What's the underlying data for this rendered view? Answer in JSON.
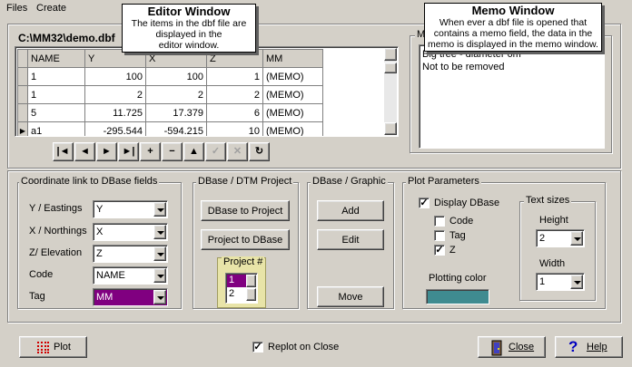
{
  "menu": {
    "files": "Files",
    "create": "Create"
  },
  "file_path": "C:\\MM32\\demo.dbf",
  "memo_group": "MM",
  "callouts": {
    "editor": {
      "title": "Editor Window",
      "line1": "The items in the dbf file are",
      "line2": "displayed in the",
      "line3": "editor window."
    },
    "memo": {
      "title": "Memo Window",
      "line1": "When ever a dbf file is opened that",
      "line2": "contains a memo field, the data in the",
      "line3": "memo is displayed in the memo window."
    }
  },
  "grid": {
    "headers": [
      "NAME",
      "Y",
      "X",
      "Z",
      "MM"
    ],
    "rows": [
      [
        "1",
        "100",
        "100",
        "1",
        "(MEMO)"
      ],
      [
        "1",
        "2",
        "2",
        "2",
        "(MEMO)"
      ],
      [
        "5",
        "11.725",
        "17.379",
        "6",
        "(MEMO)"
      ],
      [
        "a1",
        "-295.544",
        "-594.215",
        "10",
        "(MEMO)"
      ]
    ]
  },
  "memo_text": {
    "line1": "Big tree - diameter 6m",
    "line2": "Not to be removed"
  },
  "nav": [
    "|◄",
    "◄",
    "►",
    "►|",
    "+",
    "−",
    "▲",
    "✓",
    "✕",
    "↻"
  ],
  "coord": {
    "title": "Coordinate link to DBase fields",
    "rows": [
      {
        "label": "Y / Eastings",
        "value": "Y"
      },
      {
        "label": "X / Northings",
        "value": "X"
      },
      {
        "label": "Z/ Elevation",
        "value": "Z"
      },
      {
        "label": "Code",
        "value": "NAME"
      },
      {
        "label": "Tag",
        "value": "MM"
      }
    ]
  },
  "dtm": {
    "title": "DBase / DTM Project",
    "to_project": "DBase to Project",
    "to_dbase": "Project to DBase",
    "project_title": "Project #",
    "project_items": [
      "1",
      "2"
    ]
  },
  "graphic": {
    "title": "DBase / Graphic",
    "add": "Add",
    "edit": "Edit",
    "move": "Move"
  },
  "plot_params": {
    "title": "Plot Parameters",
    "display_dbase": "Display DBase",
    "code": "Code",
    "tag": "Tag",
    "z": "Z",
    "plotting_color_label": "Plotting color",
    "plotting_color": "#3f8b90",
    "text_sizes_title": "Text sizes",
    "height_label": "Height",
    "height_value": "2",
    "width_label": "Width",
    "width_value": "1"
  },
  "checks": {
    "display_dbase": true,
    "code": false,
    "tag": false,
    "z": true,
    "replot": true
  },
  "colors": {
    "tag_bg": "#8000a0",
    "project_frame": "#e8e4a8",
    "selection": "#800080"
  },
  "footer": {
    "plot": "Plot",
    "replot": "Replot on Close",
    "close": "Close",
    "help": "Help"
  }
}
